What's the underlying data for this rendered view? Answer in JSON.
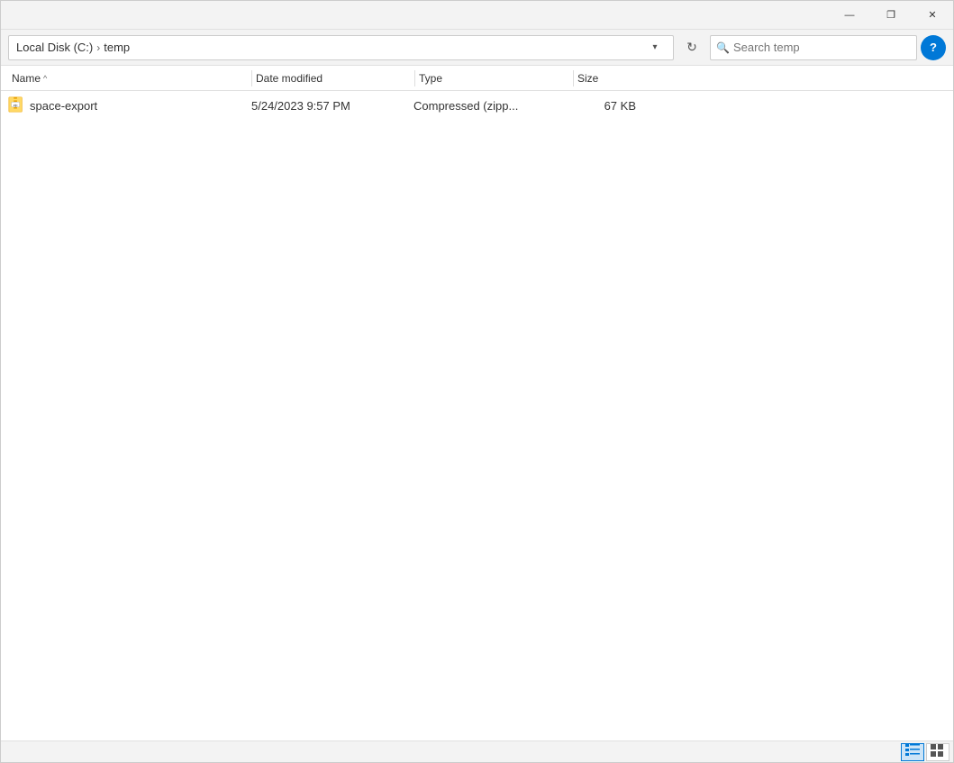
{
  "window": {
    "title_bar": {
      "minimize_label": "—",
      "maximize_label": "❐",
      "close_label": "✕"
    }
  },
  "address_bar": {
    "drive_label": "Local Disk (C:)",
    "separator": "›",
    "folder_label": "temp",
    "dropdown_icon": "▾",
    "refresh_icon": "↻"
  },
  "search": {
    "placeholder": "Search temp",
    "icon": "🔍"
  },
  "help": {
    "label": "?"
  },
  "columns": {
    "name": {
      "label": "Name",
      "sort_arrow": "^"
    },
    "date_modified": {
      "label": "Date modified"
    },
    "type": {
      "label": "Type"
    },
    "size": {
      "label": "Size"
    }
  },
  "files": [
    {
      "name": "space-export",
      "date_modified": "5/24/2023 9:57 PM",
      "type": "Compressed (zipp...",
      "size": "67 KB"
    }
  ],
  "status_bar": {
    "view_list_icon": "☰",
    "view_detail_icon": "⊞"
  }
}
